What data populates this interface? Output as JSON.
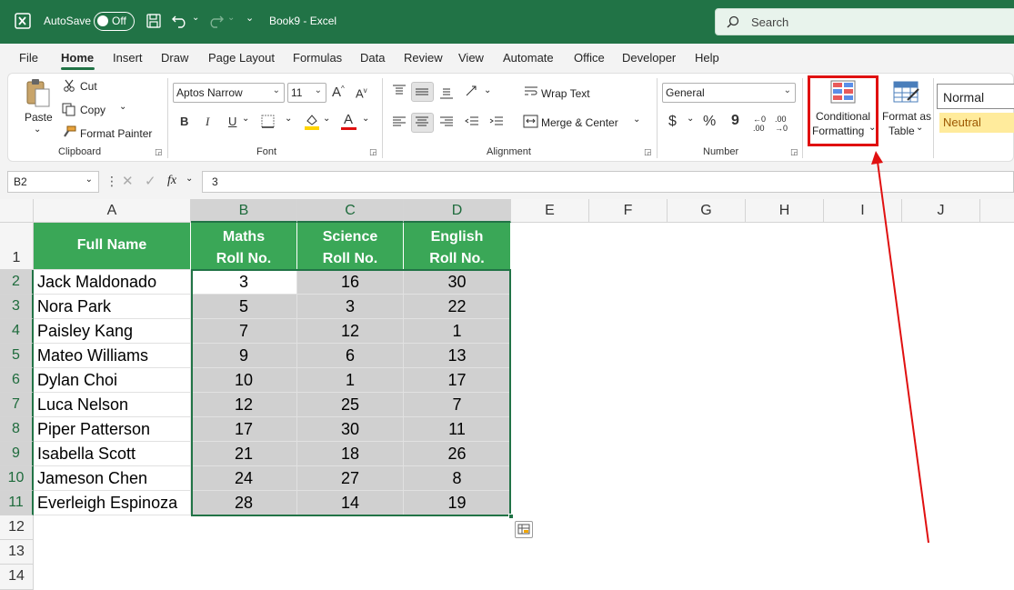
{
  "titlebar": {
    "autosave_label": "AutoSave",
    "autosave_state": "Off",
    "doc_title": "Book9 - Excel",
    "search_placeholder": "Search"
  },
  "tabs": [
    "File",
    "Home",
    "Insert",
    "Draw",
    "Page Layout",
    "Formulas",
    "Data",
    "Review",
    "View",
    "Automate",
    "Office",
    "Developer",
    "Help"
  ],
  "active_tab": "Home",
  "ribbon": {
    "clipboard": {
      "paste": "Paste",
      "cut": "Cut",
      "copy": "Copy",
      "format_painter": "Format Painter",
      "group": "Clipboard"
    },
    "font": {
      "name": "Aptos Narrow",
      "size": "11",
      "bold": "B",
      "italic": "I",
      "underline": "U",
      "group": "Font"
    },
    "alignment": {
      "wrap_text": "Wrap Text",
      "merge_center": "Merge & Center",
      "group": "Alignment"
    },
    "number": {
      "format": "General",
      "currency": "$",
      "percent": "%",
      "comma": "9",
      "group": "Number"
    },
    "styles": {
      "conditional_formatting_line1": "Conditional",
      "conditional_formatting_line2": "Formatting",
      "format_as_table_line1": "Format as",
      "format_as_table_line2": "Table",
      "normal": "Normal",
      "neutral": "Neutral"
    }
  },
  "formula_bar": {
    "name_box": "B2",
    "fx": "fx",
    "value": "3"
  },
  "columns": [
    "A",
    "B",
    "C",
    "D",
    "E",
    "F",
    "G",
    "H",
    "I",
    "J"
  ],
  "rows": [
    "1",
    "2",
    "3",
    "4",
    "5",
    "6",
    "7",
    "8",
    "9",
    "10",
    "11",
    "12",
    "13",
    "14"
  ],
  "table": {
    "headers": {
      "full_name": "Full Name",
      "maths_1": "Maths",
      "maths_2": "Roll No.",
      "science_1": "Science",
      "science_2": "Roll No.",
      "english_1": "English",
      "english_2": "Roll No."
    },
    "rows": [
      {
        "name": "Jack Maldonado",
        "maths": "3",
        "science": "16",
        "english": "30"
      },
      {
        "name": "Nora Park",
        "maths": "5",
        "science": "3",
        "english": "22"
      },
      {
        "name": "Paisley Kang",
        "maths": "7",
        "science": "12",
        "english": "1"
      },
      {
        "name": "Mateo Williams",
        "maths": "9",
        "science": "6",
        "english": "13"
      },
      {
        "name": "Dylan Choi",
        "maths": "10",
        "science": "1",
        "english": "17"
      },
      {
        "name": "Luca Nelson",
        "maths": "12",
        "science": "25",
        "english": "7"
      },
      {
        "name": "Piper Patterson",
        "maths": "17",
        "science": "30",
        "english": "11"
      },
      {
        "name": "Isabella Scott",
        "maths": "21",
        "science": "18",
        "english": "26"
      },
      {
        "name": "Jameson Chen",
        "maths": "24",
        "science": "27",
        "english": "8"
      },
      {
        "name": "Everleigh Espinoza",
        "maths": "28",
        "science": "14",
        "english": "19"
      }
    ]
  },
  "colors": {
    "excel_green": "#217346",
    "header_fill": "#3aa757",
    "selection_fill": "#d0d0d0",
    "annotation_red": "#e01010"
  }
}
